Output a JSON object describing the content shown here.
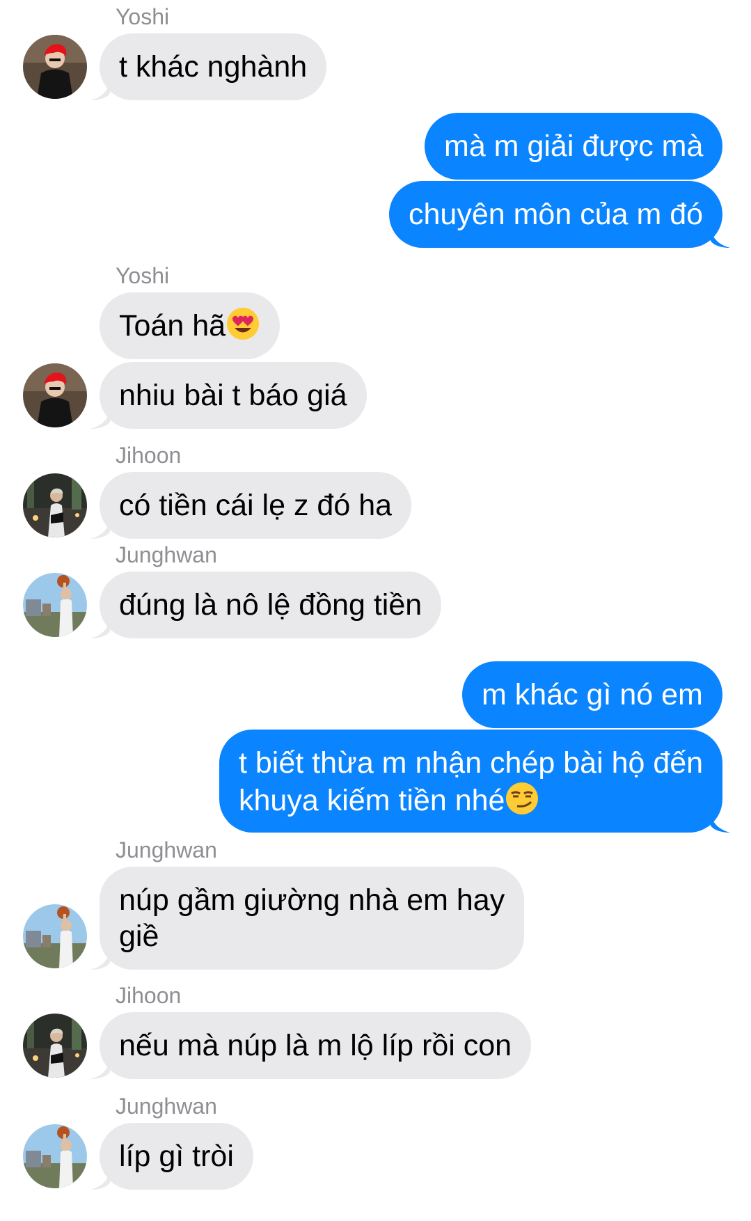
{
  "colors": {
    "incoming_bubble": "#e9e9eb",
    "outgoing_bubble": "#0b84ff",
    "incoming_text": "#000000",
    "outgoing_text": "#ffffff",
    "sender_name": "#8e8e93"
  },
  "messages": [
    {
      "sender": "Yoshi",
      "direction": "incoming",
      "text": "t khác nghành"
    },
    {
      "direction": "outgoing",
      "text": "mà m giải được mà"
    },
    {
      "direction": "outgoing",
      "text": "chuyên môn của m đó"
    },
    {
      "sender": "Yoshi",
      "direction": "incoming",
      "text": "Toán hã",
      "emoji": "heart-eyes-emoji"
    },
    {
      "direction": "incoming",
      "text": "nhiu bài t báo giá"
    },
    {
      "sender": "Jihoon",
      "direction": "incoming",
      "text": "có tiền cái lẹ z đó ha"
    },
    {
      "sender": "Junghwan",
      "direction": "incoming",
      "text": "đúng là nô lệ đồng tiền"
    },
    {
      "direction": "outgoing",
      "text": "m khác gì nó em"
    },
    {
      "direction": "outgoing",
      "text_line1": "t biết thừa m nhận chép bài hộ đến",
      "text_line2": "khuya kiếm tiền nhé",
      "emoji": "smirk-emoji"
    },
    {
      "sender": "Junghwan",
      "direction": "incoming",
      "text_line1": "núp gầm giường nhà em hay",
      "text_line2": "giề"
    },
    {
      "sender": "Jihoon",
      "direction": "incoming",
      "text": "nếu mà núp là m lộ líp rồi con"
    },
    {
      "sender": "Junghwan",
      "direction": "incoming",
      "text": "líp gì tròi"
    }
  ]
}
